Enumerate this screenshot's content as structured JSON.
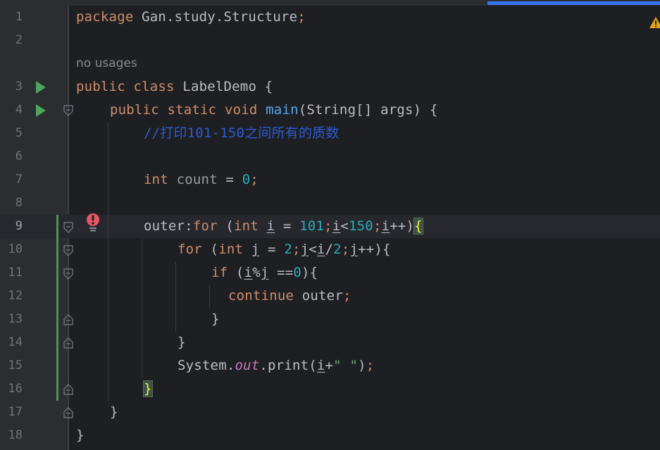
{
  "editor": {
    "usages_hint": "no usages",
    "lines": [
      {
        "n": "1"
      },
      {
        "n": "2"
      },
      {
        "n": "3"
      },
      {
        "n": "4"
      },
      {
        "n": "5"
      },
      {
        "n": "6"
      },
      {
        "n": "7"
      },
      {
        "n": "8"
      },
      {
        "n": "9"
      },
      {
        "n": "10"
      },
      {
        "n": "11"
      },
      {
        "n": "12"
      },
      {
        "n": "13"
      },
      {
        "n": "14"
      },
      {
        "n": "15"
      },
      {
        "n": "16"
      },
      {
        "n": "17"
      },
      {
        "n": "18"
      }
    ],
    "current_line": "9",
    "tokens": {
      "l1_kw": "package",
      "l1_rest": " Gan.study.Structure",
      "l1_semi": ";",
      "l3_kw1": "public",
      "l3_kw2": "class",
      "l3_rest": " LabelDemo {",
      "l4_kw1": "public",
      "l4_kw2": "static",
      "l4_kw3": "void",
      "l4_fn": "main",
      "l4_rest": "(String[] args) {",
      "l5_comment": "//打印101-150之间所有的质数",
      "l7_kw": "int",
      "l7_var": "count",
      "l7_eq": " = ",
      "l7_num": "0",
      "l7_semi": ";",
      "l9_label": "outer:",
      "l9_for": "for",
      "l9_p1": " (",
      "l9_int": "int",
      "l9_sp": " ",
      "l9_i1": "i",
      "l9_eq": " = ",
      "l9_n1": "101",
      "l9_s1": ";",
      "l9_i2": "i",
      "l9_lt": "<",
      "l9_n2": "150",
      "l9_s2": ";",
      "l9_i3": "i",
      "l9_inc": "++)",
      "l9_brace": "{",
      "l10_for": "for",
      "l10_p1": " (",
      "l10_int": "int",
      "l10_sp": " ",
      "l10_j1": "j",
      "l10_eq": " = ",
      "l10_n1": "2",
      "l10_s1": ";",
      "l10_j2": "j",
      "l10_lt": "<",
      "l10_i": "i",
      "l10_div": "/",
      "l10_n2": "2",
      "l10_s2": ";",
      "l10_j3": "j",
      "l10_inc": "++){",
      "l11_if": "if",
      "l11_p1": " (",
      "l11_i": "i",
      "l11_mod": "%",
      "l11_j": "j",
      "l11_eq": " ==",
      "l11_n": "0",
      "l11_end": "){",
      "l12_kw": "continue",
      "l12_rest": " outer",
      "l12_semi": ";",
      "l13": "}",
      "l14": "}",
      "l15_sys": "System.",
      "l15_out": "out",
      "l15_print": ".print(",
      "l15_i": "i",
      "l15_plus": "+",
      "l15_str": "\" \"",
      "l15_close": ")",
      "l15_semi": ";",
      "l16_brace": "}",
      "l17": "}",
      "l18": "}"
    }
  },
  "colors": {
    "background": "#1e1f22",
    "keyword": "#cf8e6d",
    "method": "#56a8f5",
    "number": "#2aacb8",
    "string": "#6aab73",
    "static_field": "#c77dbb",
    "comment": "#2d5bd6",
    "run_icon": "#4da65b",
    "error_icon": "#e55765",
    "warning_icon": "#e2a31e",
    "progress": "#3574f0"
  },
  "icons": [
    "run-icon",
    "fold-icon",
    "error-icon",
    "warning-icon"
  ]
}
